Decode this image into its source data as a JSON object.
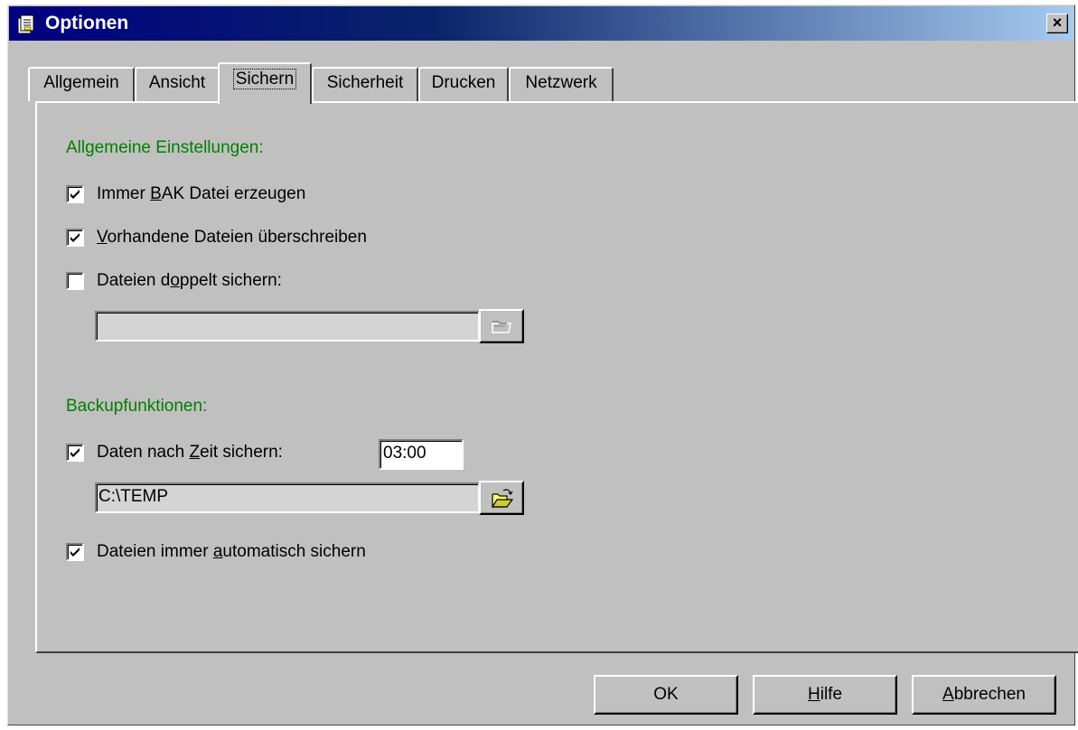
{
  "window": {
    "title": "Optionen",
    "close_glyph": "×"
  },
  "tabs": [
    {
      "label": "Allgemein",
      "active": false
    },
    {
      "label": "Ansicht",
      "active": false
    },
    {
      "label": "Sichern",
      "active": true
    },
    {
      "label": "Sicherheit",
      "active": false
    },
    {
      "label": "Drucken",
      "active": false
    },
    {
      "label": "Netzwerk",
      "active": false
    }
  ],
  "general_settings": {
    "heading": "Allgemeine Einstellungen:",
    "always_bak": {
      "pre": "Immer ",
      "accel": "B",
      "post": "AK Datei erzeugen",
      "checked": true
    },
    "overwrite": {
      "pre": "",
      "accel": "V",
      "post": "orhandene Dateien überschreiben",
      "checked": true
    },
    "double_save": {
      "pre": "Dateien d",
      "accel": "o",
      "post": "ppelt sichern:",
      "checked": false
    },
    "double_save_path": {
      "value": "",
      "enabled": false
    }
  },
  "backup": {
    "heading": "Backupfunktionen:",
    "time_save": {
      "pre": "Daten nach ",
      "accel": "Z",
      "post": "eit sichern:",
      "checked": true
    },
    "time_value": "03:00",
    "path_value": "C:\\TEMP",
    "auto_save": {
      "pre": "Dateien immer ",
      "accel": "a",
      "post": "utomatisch sichern",
      "checked": true
    }
  },
  "buttons": {
    "ok": {
      "pre": "OK",
      "accel": "",
      "post": ""
    },
    "help": {
      "pre": "",
      "accel": "H",
      "post": "ilfe"
    },
    "cancel": {
      "pre": "",
      "accel": "A",
      "post": "bbrechen"
    }
  },
  "icons": {
    "title": "options-document-icon",
    "browse_disabled": "folder-browse-disabled-icon",
    "browse": "folder-open-icon",
    "check": "checkmark-icon"
  },
  "colors": {
    "title_gradient_start": "#000080",
    "title_gradient_end": "#a6caf0",
    "face": "#c0c0c0",
    "heading_green": "#008000"
  }
}
